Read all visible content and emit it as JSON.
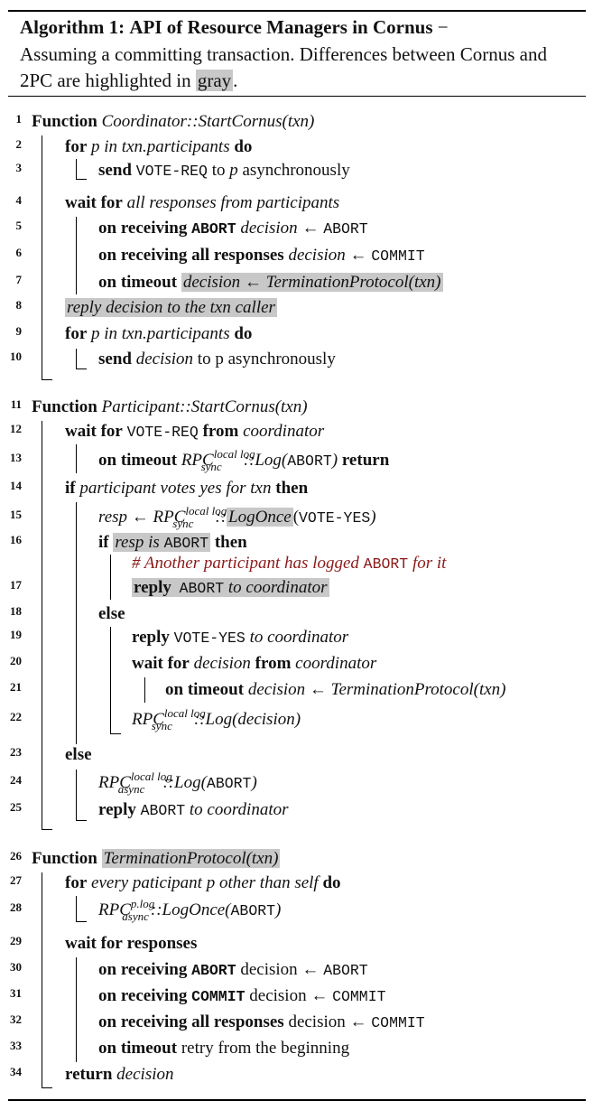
{
  "caption": {
    "label": "Algorithm 1:",
    "title": "API of Resource Managers in Cornus",
    "dash": " −",
    "text": "Assuming a committing transaction. Differences between Cornus and 2PC are highlighted in",
    "gray_word": "gray",
    "period": "."
  },
  "kw": {
    "function": "Function",
    "for": "for",
    "do": "do",
    "send": "send",
    "wait_for": "wait for",
    "on_receiving": "on receiving",
    "on_timeout": "on timeout",
    "if": "if",
    "then": "then",
    "else": "else",
    "reply": "reply",
    "from": "from",
    "return": "return",
    "all_responses": "all responses",
    "responses": "responses"
  },
  "lines": {
    "l1": {
      "num": "1",
      "name": "Coordinator::StartCornus(txn)"
    },
    "l2": {
      "num": "2",
      "cond": "p in txn.participants"
    },
    "l3": {
      "num": "3",
      "msg": "VOTE-REQ",
      "rest": "to p asynchronously",
      "to": "to",
      "p": "p",
      "asyn": "asynchronously"
    },
    "l4": {
      "num": "4",
      "cond": "all responses from participants"
    },
    "l5": {
      "num": "5",
      "abort": "ABORT",
      "lhs": "decision",
      "arrow": "←",
      "rhs": "ABORT"
    },
    "l6": {
      "num": "6",
      "lhs": "decision",
      "arrow": "←",
      "rhs": "COMMIT"
    },
    "l7": {
      "num": "7",
      "stmt": "decision ← TerminationProtocol(txn)"
    },
    "l8": {
      "num": "8",
      "stmt": "reply decision to the txn caller"
    },
    "l9": {
      "num": "9",
      "cond": "p in txn.participants"
    },
    "l10": {
      "num": "10",
      "obj": "decision",
      "rest": "to p asynchronously"
    },
    "l11": {
      "num": "11",
      "name": "Participant::StartCornus(txn)"
    },
    "l12": {
      "num": "12",
      "msg": "VOTE-REQ",
      "src": "coordinator"
    },
    "l13": {
      "num": "13",
      "rpc": "RPC",
      "sup": "local log",
      "sub": "sync",
      "call": "::Log(",
      "arg": "ABORT",
      "close": ")"
    },
    "l14": {
      "num": "14",
      "cond": "participant votes yes for txn"
    },
    "l15": {
      "num": "15",
      "lhs": "resp",
      "arrow": "←",
      "rpc": "RPC",
      "sup": "local log",
      "sub": "sync",
      "sep": "::",
      "call": "LogOnce",
      "open": "(",
      "arg": "VOTE-YES",
      "close": ")"
    },
    "l16": {
      "num": "16",
      "cond_a": "resp is",
      "cond_b": "ABORT"
    },
    "comment": {
      "text_a": "# Another participant has logged",
      "tt": "ABORT",
      "text_b": "for it"
    },
    "l17": {
      "num": "17",
      "msg": "ABORT",
      "rest": "to coordinator"
    },
    "l18": {
      "num": "18"
    },
    "l19": {
      "num": "19",
      "msg": "VOTE-YES",
      "rest": "to coordinator"
    },
    "l20": {
      "num": "20",
      "obj": "decision",
      "src": "coordinator"
    },
    "l21": {
      "num": "21",
      "stmt": "decision ← TerminationProtocol(txn)"
    },
    "l22": {
      "num": "22",
      "rpc": "RPC",
      "sup": "local log",
      "sub": "sync",
      "call": "::Log(decision)"
    },
    "l23": {
      "num": "23"
    },
    "l24": {
      "num": "24",
      "rpc": "RPC",
      "sup": "local log",
      "sub": "async",
      "call": "::Log(",
      "arg": "ABORT",
      "close": ")"
    },
    "l25": {
      "num": "25",
      "msg": "ABORT",
      "rest": "to coordinator"
    },
    "l26": {
      "num": "26",
      "name": "TerminationProtocol(txn)"
    },
    "l27": {
      "num": "27",
      "cond": "every paticipant p other than self"
    },
    "l28": {
      "num": "28",
      "rpc": "RPC",
      "sup": "p.log",
      "sub": "async",
      "call": "::LogOnce(",
      "arg": "ABORT",
      "close": ")"
    },
    "l29": {
      "num": "29"
    },
    "l30": {
      "num": "30",
      "msg": "ABORT",
      "rest": "decision ←",
      "rhs": "ABORT"
    },
    "l31": {
      "num": "31",
      "msg": "COMMIT",
      "rest": "decision ←",
      "rhs": "COMMIT"
    },
    "l32": {
      "num": "32",
      "rest": "decision ←",
      "rhs": "COMMIT"
    },
    "l33": {
      "num": "33",
      "rest": "retry from the beginning"
    },
    "l34": {
      "num": "34",
      "obj": "decision"
    }
  }
}
